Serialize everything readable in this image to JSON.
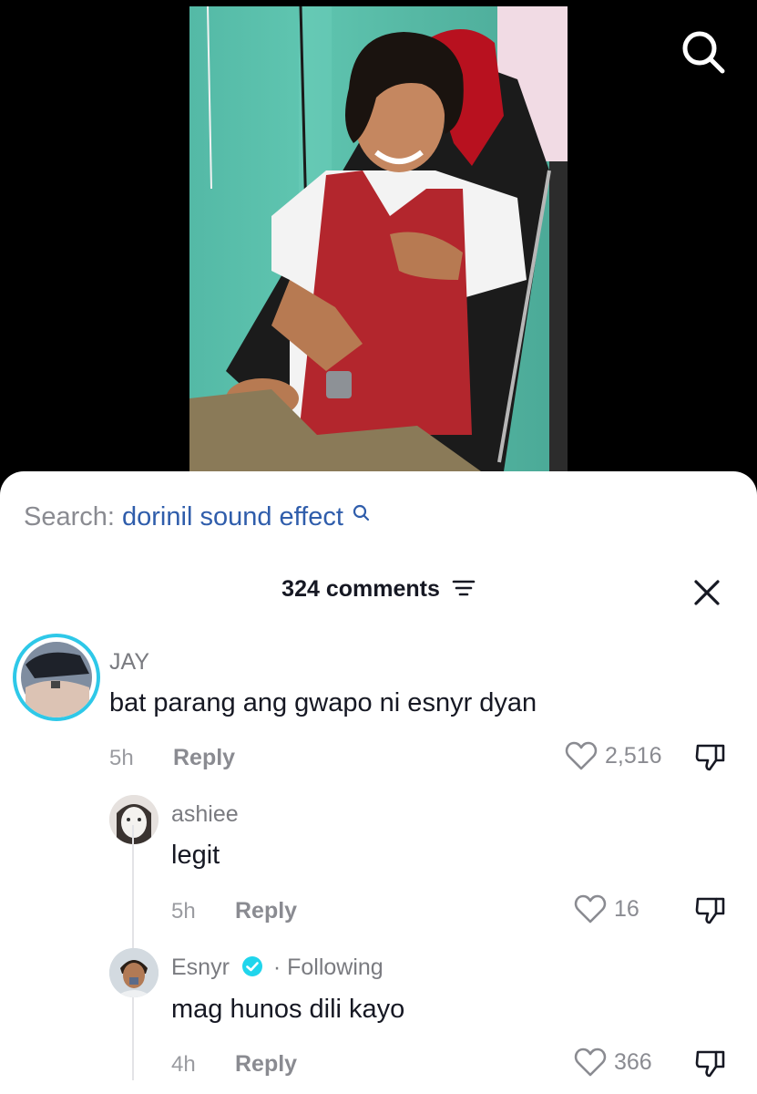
{
  "search": {
    "prefix": "Search:",
    "query": "dorinil sound effect"
  },
  "comments_header": {
    "count_label": "324 comments"
  },
  "comments": [
    {
      "username": "JAY",
      "text": "bat parang ang gwapo ni esnyr dyan",
      "time": "5h",
      "reply_label": "Reply",
      "likes": "2,516"
    },
    {
      "username": "ashiee",
      "text": "legit",
      "time": "5h",
      "reply_label": "Reply",
      "likes": "16"
    },
    {
      "username": "Esnyr",
      "following_label": "· Following",
      "text": "mag hunos dili kayo",
      "time": "4h",
      "reply_label": "Reply",
      "likes": "366"
    }
  ],
  "colors": {
    "accent_link": "#2f5dab",
    "verified": "#20d5ec",
    "story_ring": "#2ec8e8",
    "text_primary": "#161823",
    "text_secondary": "#8a8b91"
  },
  "icons": {
    "search": "search-icon",
    "filter": "filter-icon",
    "close": "close-icon",
    "like": "heart-icon",
    "dislike": "thumbs-down-icon",
    "verified": "verified-badge-icon"
  }
}
